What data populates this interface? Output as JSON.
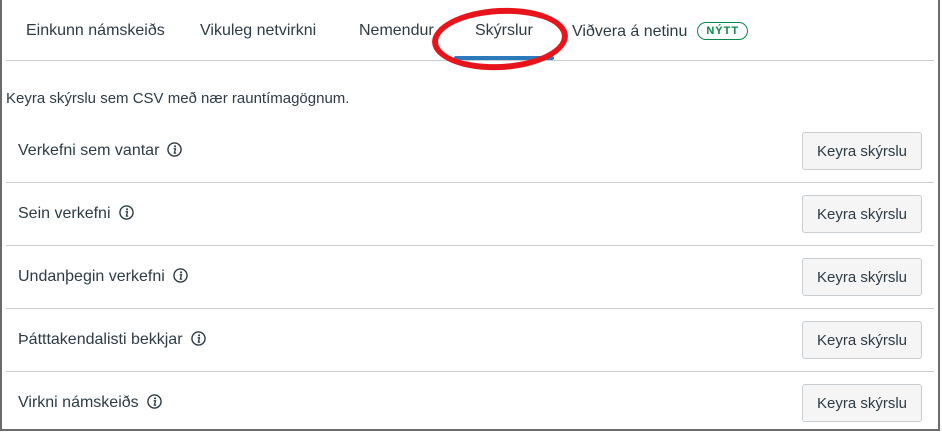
{
  "tabs": [
    {
      "label": "Einkunn námskeiðs",
      "active": false
    },
    {
      "label": "Vikuleg netvirkni",
      "active": false
    },
    {
      "label": "Nemendur",
      "active": false
    },
    {
      "label": "Skýrslur",
      "active": true
    },
    {
      "label": "Viðvera á netinu",
      "active": false,
      "badge": "NÝTT"
    }
  ],
  "intro_text": "Keyra skýrslu sem CSV með nær rauntímagögnum.",
  "reports": [
    {
      "name": "Verkefni sem vantar",
      "button": "Keyra skýrslu"
    },
    {
      "name": "Sein verkefni",
      "button": "Keyra skýrslu"
    },
    {
      "name": "Undanþegin verkefni",
      "button": "Keyra skýrslu"
    },
    {
      "name": "Þátttakendalisti bekkjar",
      "button": "Keyra skýrslu"
    },
    {
      "name": "Virkni námskeiðs",
      "button": "Keyra skýrslu"
    }
  ],
  "colors": {
    "active_tab_underline": "#2b7abc",
    "badge": "#0b874b",
    "highlight_ring": "#e8141b"
  },
  "icons": {
    "info": "info-circle-icon"
  }
}
